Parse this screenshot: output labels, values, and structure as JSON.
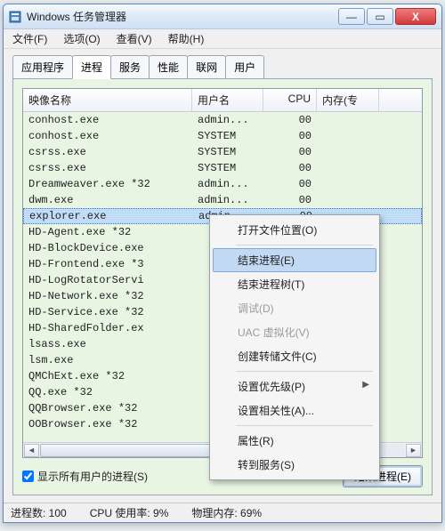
{
  "window": {
    "title": "Windows 任务管理器"
  },
  "winbtns": {
    "min": "—",
    "max": "▭",
    "close": "X"
  },
  "menu": {
    "file": "文件(F)",
    "options": "选项(O)",
    "view": "查看(V)",
    "help": "帮助(H)"
  },
  "tabs": {
    "apps": "应用程序",
    "processes": "进程",
    "services": "服务",
    "performance": "性能",
    "networking": "联网",
    "users": "用户"
  },
  "columns": {
    "name": "映像名称",
    "user": "用户名",
    "cpu": "CPU",
    "mem": "内存(专"
  },
  "rows": [
    {
      "name": "conhost.exe",
      "user": "admin...",
      "cpu": "00",
      "sel": false
    },
    {
      "name": "conhost.exe",
      "user": "SYSTEM",
      "cpu": "00",
      "sel": false
    },
    {
      "name": "csrss.exe",
      "user": "SYSTEM",
      "cpu": "00",
      "sel": false
    },
    {
      "name": "csrss.exe",
      "user": "SYSTEM",
      "cpu": "00",
      "sel": false
    },
    {
      "name": "Dreamweaver.exe *32",
      "user": "admin...",
      "cpu": "00",
      "sel": false
    },
    {
      "name": "dwm.exe",
      "user": "admin...",
      "cpu": "00",
      "sel": false
    },
    {
      "name": "explorer.exe",
      "user": "admin",
      "cpu": "00",
      "sel": true
    },
    {
      "name": "HD-Agent.exe *32",
      "user": "",
      "cpu": "",
      "sel": false
    },
    {
      "name": "HD-BlockDevice.exe",
      "user": "",
      "cpu": "",
      "sel": false
    },
    {
      "name": "HD-Frontend.exe *3",
      "user": "",
      "cpu": "",
      "sel": false
    },
    {
      "name": "HD-LogRotatorServi",
      "user": "",
      "cpu": "",
      "sel": false
    },
    {
      "name": "HD-Network.exe *32",
      "user": "",
      "cpu": "",
      "sel": false
    },
    {
      "name": "HD-Service.exe *32",
      "user": "",
      "cpu": "",
      "sel": false
    },
    {
      "name": "HD-SharedFolder.ex",
      "user": "",
      "cpu": "",
      "sel": false
    },
    {
      "name": "lsass.exe",
      "user": "",
      "cpu": "",
      "sel": false
    },
    {
      "name": "lsm.exe",
      "user": "",
      "cpu": "",
      "sel": false
    },
    {
      "name": "QMChExt.exe *32",
      "user": "",
      "cpu": "",
      "sel": false
    },
    {
      "name": "QQ.exe *32",
      "user": "",
      "cpu": "",
      "sel": false
    },
    {
      "name": "QQBrowser.exe *32",
      "user": "",
      "cpu": "",
      "sel": false
    },
    {
      "name": "OOBrowser.exe *32",
      "user": "",
      "cpu": "",
      "sel": false
    }
  ],
  "scroll": {
    "left": "◄",
    "right": "►"
  },
  "footer": {
    "checkbox": "显示所有用户的进程(S)",
    "endbtn": "结束进程(E)"
  },
  "status": {
    "procs": "进程数: 100",
    "cpu": "CPU 使用率: 9%",
    "mem": "物理内存: 69%"
  },
  "ctx": {
    "open_loc": "打开文件位置(O)",
    "end_proc": "结束进程(E)",
    "end_tree": "结束进程树(T)",
    "debug": "调试(D)",
    "uac": "UAC 虚拟化(V)",
    "dump": "创建转储文件(C)",
    "priority": "设置优先级(P)",
    "affinity": "设置相关性(A)...",
    "props": "属性(R)",
    "goto_svc": "转到服务(S)"
  }
}
